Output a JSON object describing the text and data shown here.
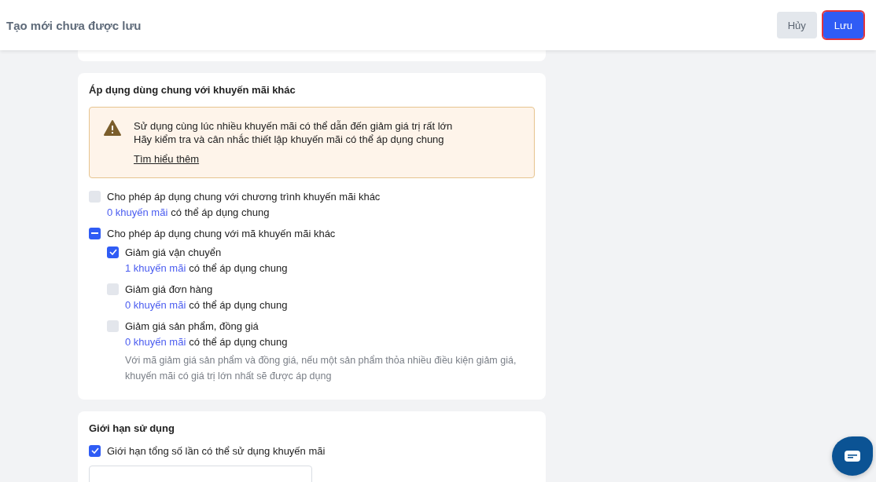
{
  "header": {
    "title": "Tạo mới chưa được lưu",
    "buttons": [
      {
        "label": "Hủy",
        "kind": "secondary",
        "highlighted": false
      },
      {
        "label": "Lưu",
        "kind": "primary",
        "highlighted": true
      }
    ]
  },
  "combine_card": {
    "title": "Áp dụng dùng chung với khuyến mãi khác",
    "warning": {
      "lines": [
        "Sử dụng cùng lúc nhiều khuyến mãi có thể dẫn đến giảm giá trị rất lớn",
        "Hãy kiểm tra và cân nhắc thiết lập khuyến mãi có thể áp dụng chung"
      ],
      "link": "Tìm hiểu thêm"
    },
    "options": [
      {
        "label": "Cho phép áp dụng chung với chương trình khuyến mãi khác",
        "checked": false,
        "indeterminate": false,
        "count_link": "0 khuyến mãi",
        "count_suffix": "có thể áp dụng chung"
      },
      {
        "label": "Cho phép áp dụng chung với mã khuyến mãi khác",
        "checked": false,
        "indeterminate": true,
        "children": [
          {
            "label": "Giảm giá vận chuyển",
            "checked": true,
            "count_link": "1 khuyến mãi",
            "count_suffix": "có thể áp dụng chung"
          },
          {
            "label": "Giảm giá đơn hàng",
            "checked": false,
            "count_link": "0 khuyến mãi",
            "count_suffix": "có thể áp dụng chung"
          },
          {
            "label": "Giảm giá sản phẩm, đồng giá",
            "checked": false,
            "count_link": "0 khuyến mãi",
            "count_suffix": "có thể áp dụng chung",
            "note": "Với mã giảm giá sản phẩm và đồng giá, nếu một sản phẩm thỏa nhiều điều kiện giảm giá, khuyến mãi có giá trị lớn nhất sẽ được áp dụng"
          }
        ]
      }
    ]
  },
  "limit_card": {
    "title": "Giới hạn sử dụng",
    "options": [
      {
        "label": "Giới hạn tổng số lần có thể sử dụng khuyến mãi",
        "checked": true
      }
    ]
  }
}
